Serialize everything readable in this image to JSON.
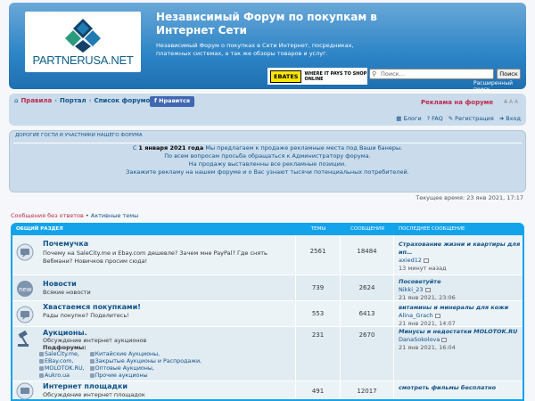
{
  "header": {
    "logo_text": "PARTNERUSA.NET",
    "title": "Независимый Форум по покупкам в Интернет Сети",
    "description": "Независимый Форум о покупках в Сети Интернет, посредниках, платежных системах, а так же обзоры товаров и услуг.",
    "ebates_logo": "EBATES",
    "ebates_text": "WHERE IT PAYS TO SHOP ONLINE",
    "search_placeholder": "Поиск…",
    "search_button": "Поиск",
    "advanced_search": "Расширенный поиск"
  },
  "nav": {
    "rules": "Правила",
    "portal": "Портал",
    "forum_list": "Список форумов",
    "like": "Нравится",
    "ads": "Реклама на форуме",
    "font_controls": "A̶ A A",
    "blogs": "Блоги",
    "faq": "FAQ",
    "register": "Регистрация",
    "login": "Вход"
  },
  "announce": {
    "title": "ДОРОГИЕ ГОСТИ И УЧАСТНИКИ НАШЕГО ФОРУМА",
    "line1_pre": "С ",
    "line1_bold": "1 января 2021 года",
    "line1_post": " Мы предлагаем к продаже рекламные места под Ваши банеры.",
    "line2": "По всем вопросам просьба обращаться к Администратору форума.",
    "line3": "На продажу выставленны все рекламные позиции.",
    "line4": "Закажите рекламу на нашем форуме и о Вас узнают тысячи потенциальных потребителей."
  },
  "current_time": "Текущее время: 23 янв 2021, 17:17",
  "quick_links": {
    "unanswered": "Сообщения без ответов",
    "sep": " • ",
    "active": "Активные темы"
  },
  "table": {
    "headers": {
      "section": "ОБЩИЙ РАЗДЕЛ",
      "topics": "ТЕМЫ",
      "posts": "СООБЩЕНИЯ",
      "last": "ПОСЛЕДНЕЕ СООБЩЕНИЕ"
    },
    "forums": [
      {
        "name": "Почемучка",
        "desc": "Почему на SaleCity.me и Ebay.com дешевле? Зачем мне PayPal? Где снять Вебмани? Новичков просим сюда!",
        "topics": "2561",
        "posts": "18484",
        "last_title": "Страхование жизни и квартиры для ип…",
        "last_user": "axied12",
        "last_date": "13 минут назад"
      },
      {
        "name": "Новости",
        "desc": "Всякие новости",
        "topics": "739",
        "posts": "2624",
        "last_title": "Посоветуйте",
        "last_user": "Nikki_23",
        "last_date": "21 янв 2021, 23:06"
      },
      {
        "name": "Хвастаемся покупками!",
        "desc": "Рады покупке? Поделитесь!",
        "topics": "553",
        "posts": "6413",
        "last_title": "витамины и минералы для кожи",
        "last_user": "Alina_Grach",
        "last_date": "21 янв 2021, 14:07"
      },
      {
        "name": "Аукционы.",
        "desc": "Обсуждение интернет аукционов",
        "subforums_label": "Подфорумы:",
        "subforums": [
          "SaleCity.me,",
          "Китайские Аукционы,",
          "",
          "EBay.com,",
          "Закрытые Аукционы и Распродажи,",
          "",
          "MOLOTOK.RU,",
          "Оптовые Аукционы,",
          "",
          "Aukro.ua",
          "Прочие аукционы",
          ""
        ],
        "topics": "231",
        "posts": "2670",
        "last_title": "Минусы и недостатки MOLOTOK.RU",
        "last_user": "DanaSokolova",
        "last_date": "21 янв 2021, 16:04"
      },
      {
        "name": "Интернет площадки",
        "desc": "Обсуждение интернет площадок",
        "topics": "491",
        "posts": "12017",
        "last_title": "смотреть фильмы бесплатно",
        "last_user": "",
        "last_date": ""
      }
    ]
  },
  "colors": {
    "header": "#2c84c6",
    "nav": "#cadceb",
    "table_head": "#12a3eb",
    "link": "#105289",
    "accent": "#bc2a4d"
  }
}
